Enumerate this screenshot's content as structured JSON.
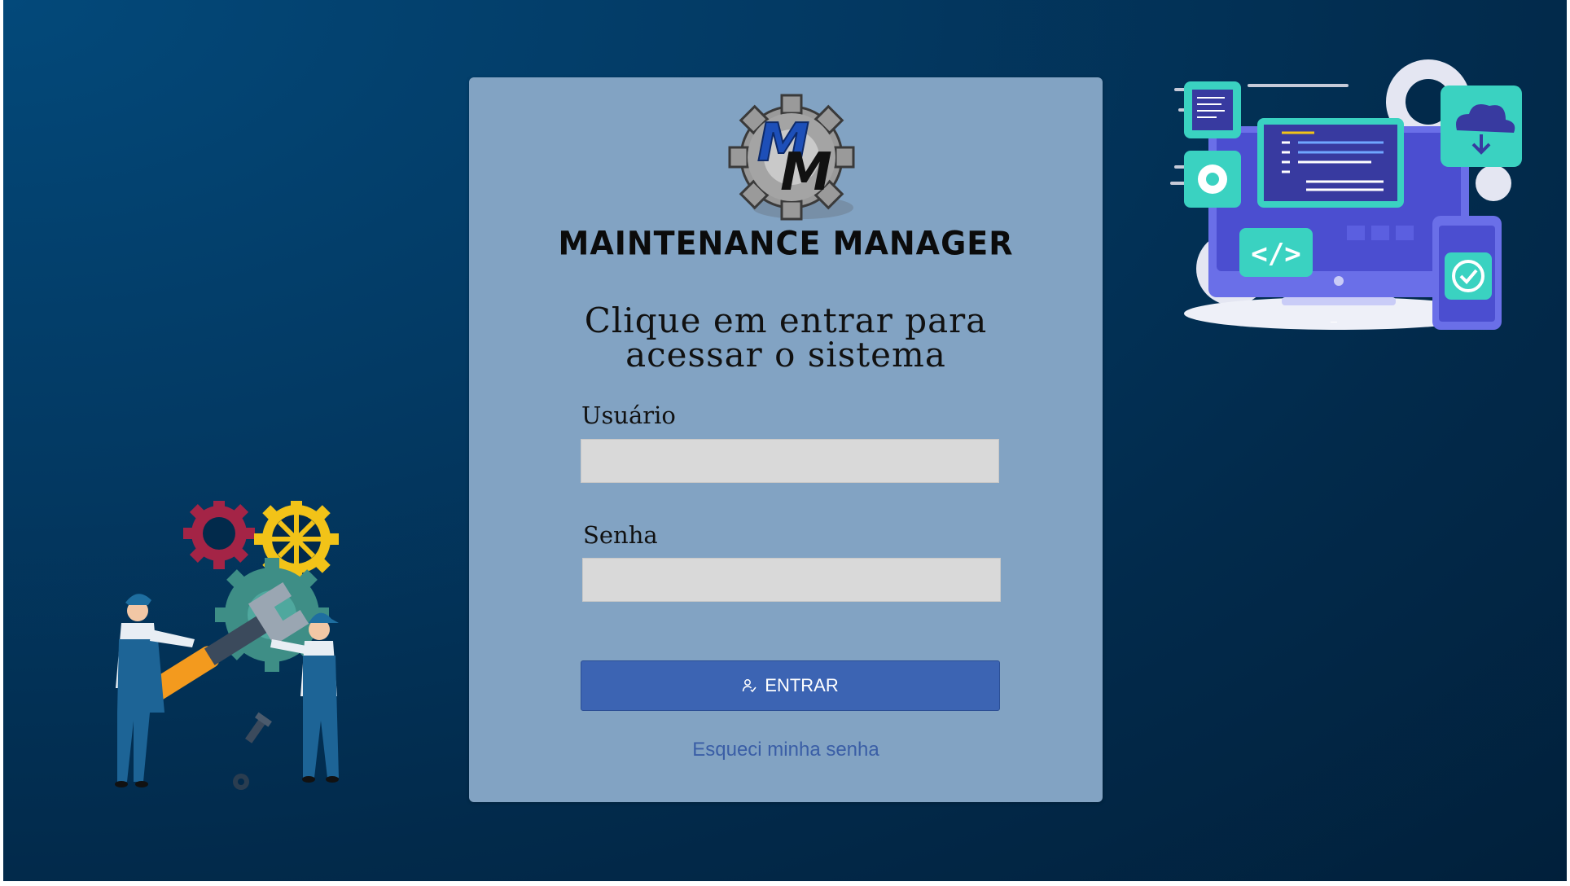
{
  "app": {
    "logo_monogram": "MM",
    "logo_text": "MAINTENANCE MANAGER"
  },
  "login": {
    "heading_line1": "Clique em entrar para",
    "heading_line2": "acessar o sistema",
    "user_label": "Usuário",
    "user_value": "",
    "password_label": "Senha",
    "password_value": "",
    "submit_label": "ENTRAR",
    "submit_icon": "user-check-icon",
    "forgot_label": "Esqueci minha senha"
  },
  "colors": {
    "background": "#033a64",
    "card": "#82a3c3",
    "button": "#3c64b3",
    "link": "#3a5ea6",
    "input": "#d9d9d9"
  },
  "illustrations": {
    "left": "mechanics-with-gears-illustration",
    "right": "software-development-devices-illustration"
  }
}
